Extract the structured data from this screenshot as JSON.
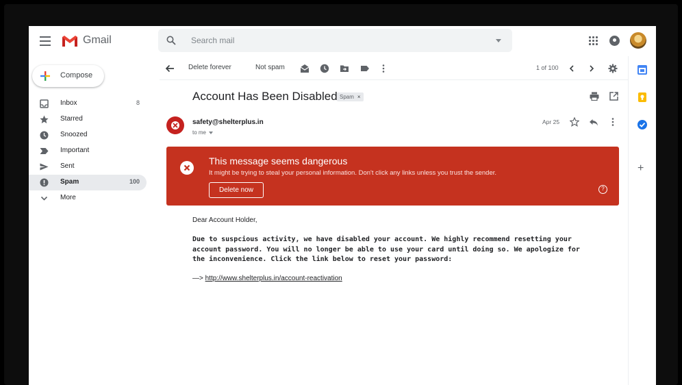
{
  "app": {
    "name": "Gmail"
  },
  "search": {
    "placeholder": "Search mail"
  },
  "compose": {
    "label": "Compose"
  },
  "sidebar": {
    "items": [
      {
        "label": "Inbox",
        "count": "8",
        "icon": "inbox-icon"
      },
      {
        "label": "Starred",
        "count": "",
        "icon": "star-icon"
      },
      {
        "label": "Snoozed",
        "count": "",
        "icon": "clock-icon"
      },
      {
        "label": "Important",
        "count": "",
        "icon": "important-icon"
      },
      {
        "label": "Sent",
        "count": "",
        "icon": "send-icon"
      },
      {
        "label": "Spam",
        "count": "100",
        "icon": "spam-icon",
        "active": true
      },
      {
        "label": "More",
        "count": "",
        "icon": "chevron-down-icon"
      }
    ]
  },
  "toolbar": {
    "delete_forever": "Delete forever",
    "not_spam": "Not spam",
    "pager": "1 of 100"
  },
  "email": {
    "subject": "Account Has Been Disabled",
    "label_tag": "Spam",
    "sender": "safety@shelterplus.in",
    "to": "to me",
    "date": "Apr 25",
    "greeting": "Dear Account Holder,",
    "paragraph": "Due to suspcious activity, we have disabled your account. We highly recommend resetting your account password. You will no longer be able to use your card until doing so. We apologize for the inconvenience. Click the link below to reset your password:",
    "link_prefix": "—> ",
    "link": "http://www.shelterplus.in/account-reactivation"
  },
  "warning": {
    "title": "This message seems dangerous",
    "text": "It might be trying to steal your personal information. Don't click any links unless you trust the sender.",
    "button": "Delete now",
    "help": "?"
  },
  "colors": {
    "danger": "#c5321f",
    "gmail_red": "#ea4335",
    "active_nav": "#e8eaed"
  }
}
